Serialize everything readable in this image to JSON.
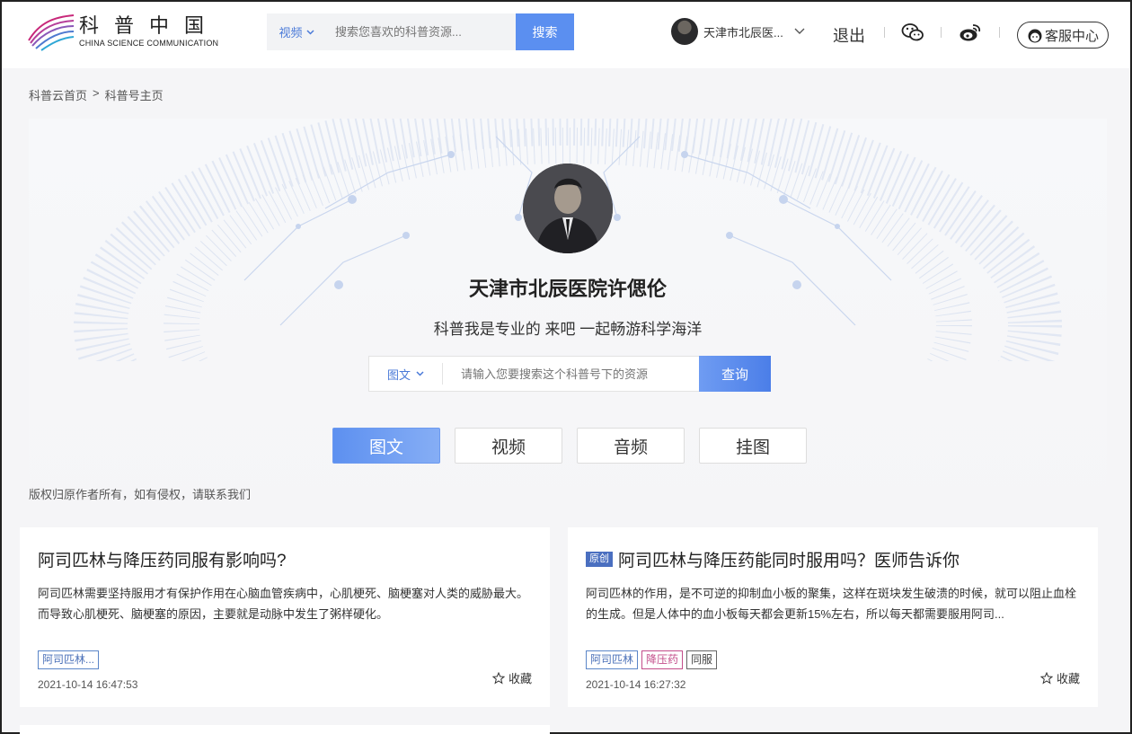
{
  "header": {
    "logo_cn": "科普中国",
    "logo_en": "CHINA SCIENCE COMMUNICATION",
    "search_type": "视频",
    "search_placeholder": "搜索您喜欢的科普资源...",
    "search_button": "搜索",
    "user_name": "天津市北辰医...",
    "logout": "退出",
    "service": "客服中心"
  },
  "breadcrumb": {
    "home": "科普云首页",
    "sep": ">",
    "current": "科普号主页"
  },
  "profile": {
    "name": "天津市北辰医院许偲伦",
    "motto": "科普我是专业的 来吧 一起畅游科学海洋",
    "search_type": "图文",
    "search_placeholder": "请输入您要搜索这个科普号下的资源",
    "search_button": "查询"
  },
  "tabs": [
    {
      "label": "图文",
      "active": true
    },
    {
      "label": "视频",
      "active": false
    },
    {
      "label": "音频",
      "active": false
    },
    {
      "label": "挂图",
      "active": false
    }
  ],
  "copyright": "版权归原作者所有，如有侵权，请联系我们",
  "articles": [
    {
      "badge": "",
      "title": "阿司匹林与降压药同服有影响吗?",
      "desc": "阿司匹林需要坚持服用才有保护作用在心脑血管疾病中，心肌梗死、脑梗塞对人类的威胁最大。而导致心肌梗死、脑梗塞的原因，主要就是动脉中发生了粥样硬化。",
      "tags": [
        {
          "text": "阿司匹林...",
          "style": "blue"
        }
      ],
      "date": "2021-10-14 16:47:53",
      "fav": "收藏"
    },
    {
      "badge": "原创",
      "title": "阿司匹林与降压药能同时服用吗？医师告诉你",
      "desc": "阿司匹林的作用，是不可逆的抑制血小板的聚集，这样在斑块发生破溃的时候，就可以阻止血栓的生成。但是人体中的血小板每天都会更新15%左右，所以每天都需要服用阿司...",
      "tags": [
        {
          "text": "阿司匹林",
          "style": "blue"
        },
        {
          "text": "降压药",
          "style": "pink"
        },
        {
          "text": "同服",
          "style": "gray"
        }
      ],
      "date": "2021-10-14 16:27:32",
      "fav": "收藏"
    }
  ],
  "colors": {
    "accent": "#5b8ff0",
    "link": "#4a7ad8",
    "badge": "#4a6fc0",
    "tag_pink": "#c34d8a"
  }
}
